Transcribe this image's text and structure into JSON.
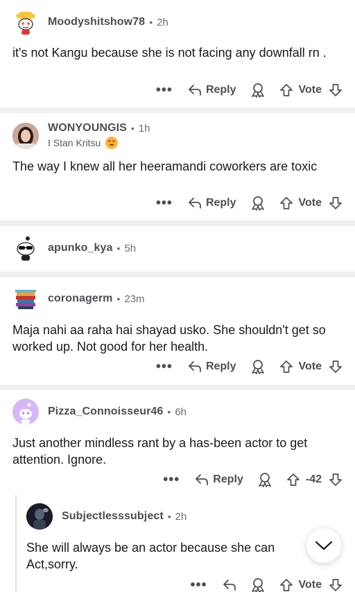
{
  "comments": [
    {
      "username": "Moodyshitshow78",
      "time": "2h",
      "body": "it's not Kangu because she is not facing any downfall rn .",
      "reply_label": "Reply",
      "vote_label": "Vote",
      "avatar_icon": "snoo-yellow-hat-avatar"
    },
    {
      "username": "WONYOUNGIS",
      "time": "1h",
      "flair": "I Stan Kritsu",
      "body": "The way I knew all her heeramandi coworkers are toxic",
      "reply_label": "Reply",
      "vote_label": "Vote",
      "avatar_icon": "photo-avatar"
    },
    {
      "username": "apunko_kya",
      "time": "5h",
      "avatar_icon": "snoo-sunglasses-avatar"
    },
    {
      "username": "coronagerm",
      "time": "23m",
      "body": "Maja nahi aa raha hai shayad usko. She shouldn't get so worked up. Not good for her health.",
      "reply_label": "Reply",
      "vote_label": "Vote",
      "avatar_icon": "pixel-art-avatar"
    },
    {
      "username": "Pizza_Connoisseur46",
      "time": "6h",
      "body": "Just another mindless rant by a has-been actor to get attention. Ignore.",
      "reply_label": "Reply",
      "vote_label": "-42",
      "avatar_icon": "default-purple-snoo-avatar"
    },
    {
      "username": "Subjectlesssubject",
      "time": "2h",
      "body": "She will always be an actor because she can Act,sorry.",
      "vote_label": "Vote",
      "avatar_icon": "dark-photo-avatar"
    }
  ],
  "separator_dot": "•",
  "more_label": "•••",
  "colors": {
    "text": "#1a1a1b",
    "meta": "#4b4f53",
    "separator": "#efefef",
    "thread_line": "#e0e0e0"
  }
}
